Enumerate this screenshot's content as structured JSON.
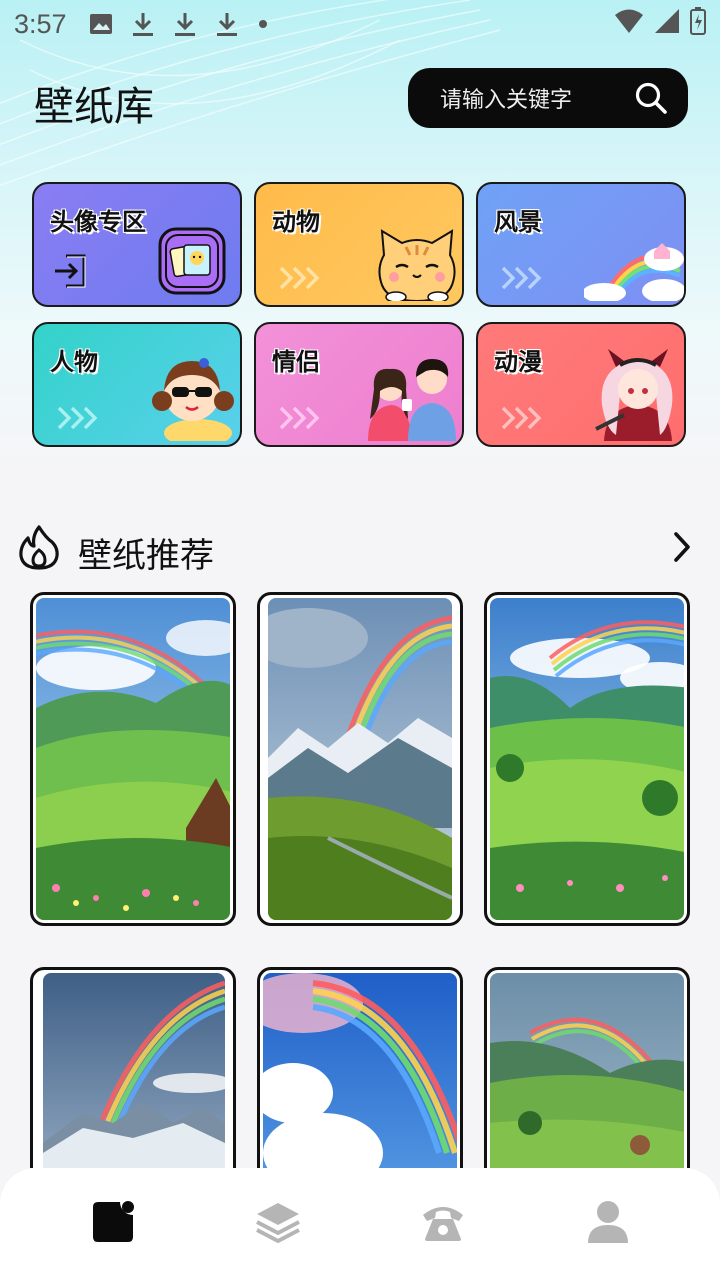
{
  "status_bar": {
    "time": "3:57",
    "icons": [
      "image-icon",
      "download-icon",
      "download-icon",
      "download-icon",
      "dot-icon",
      "wifi-icon",
      "signal-icon",
      "battery-icon"
    ]
  },
  "header": {
    "title": "壁纸库",
    "search_placeholder": "请输入关键字"
  },
  "categories": [
    {
      "label": "头像专区",
      "color": "#8b7cf4"
    },
    {
      "label": "动物",
      "color": "#ffbf52"
    },
    {
      "label": "风景",
      "color": "#6e9bf7"
    },
    {
      "label": "人物",
      "color": "#3cd3cf"
    },
    {
      "label": "情侣",
      "color": "#f08ad6"
    },
    {
      "label": "动漫",
      "color": "#ff7676"
    }
  ],
  "section": {
    "title": "壁纸推荐"
  },
  "wallpapers": [
    {
      "name": "rainbow-valley-village"
    },
    {
      "name": "rainbow-mountain-meadow"
    },
    {
      "name": "rainbow-green-valley"
    },
    {
      "name": "rainbow-snowy-mountains"
    },
    {
      "name": "rainbow-blue-clouds"
    },
    {
      "name": "rainbow-rainy-hills"
    }
  ],
  "tab_bar": {
    "tabs": [
      "wallpaper-tab",
      "layers-tab",
      "phone-tab",
      "profile-tab"
    ],
    "active_index": 0
  },
  "colors": {
    "accent": "#0b0b0b",
    "inactive_icon": "#b5b5b5"
  }
}
